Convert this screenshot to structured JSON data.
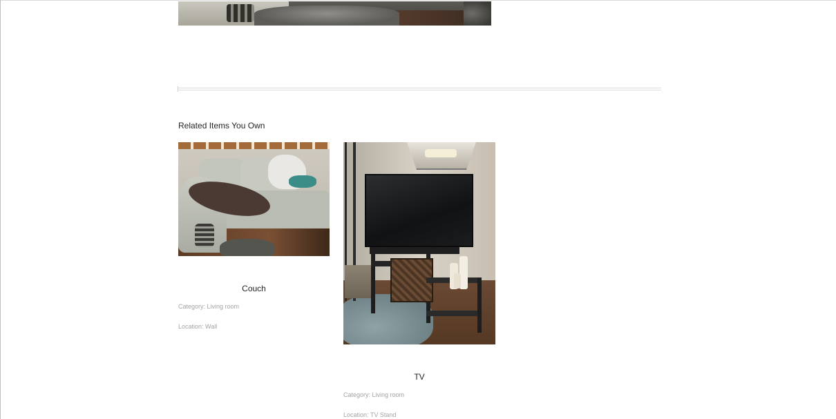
{
  "section": {
    "title": "Related Items You Own"
  },
  "items": [
    {
      "name": "Couch",
      "category": "Category: Living room",
      "location": "Location: Wall"
    },
    {
      "name": "TV",
      "category": "Category: Living room",
      "location": "Location: TV Stand"
    }
  ]
}
